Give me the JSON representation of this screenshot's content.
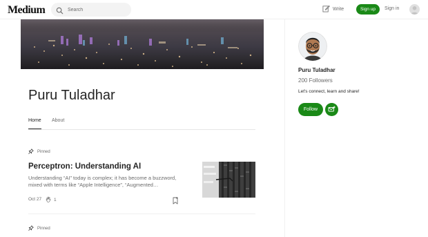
{
  "header": {
    "logo": "Medium",
    "search_placeholder": "Search",
    "write_label": "Write",
    "signup_label": "Sign up",
    "signin_label": "Sign in"
  },
  "profile": {
    "name": "Puru Tuladhar",
    "tabs": [
      {
        "label": "Home",
        "active": true
      },
      {
        "label": "About",
        "active": false
      }
    ]
  },
  "posts": [
    {
      "pinned_label": "Pinned",
      "title": "Perceptron: Understanding AI",
      "subtitle": "Understanding “AI” today is complex; it has become a buzzword, mixed with terms like “Apple Intelligence”, “Augmented…",
      "date": "Oct 27",
      "claps": "1"
    },
    {
      "pinned_label": "Pinned"
    }
  ],
  "sidebar": {
    "name": "Puru Tuladhar",
    "followers": "200 Followers",
    "bio": "Let's connect, learn and share!",
    "follow_label": "Follow"
  },
  "colors": {
    "accent_green": "#1a8917",
    "text_primary": "#242424",
    "text_secondary": "#6b6b6b"
  },
  "icons": [
    "search-icon",
    "write-icon",
    "user-avatar-icon",
    "pin-icon",
    "clap-icon",
    "bookmark-icon",
    "mail-plus-icon"
  ]
}
